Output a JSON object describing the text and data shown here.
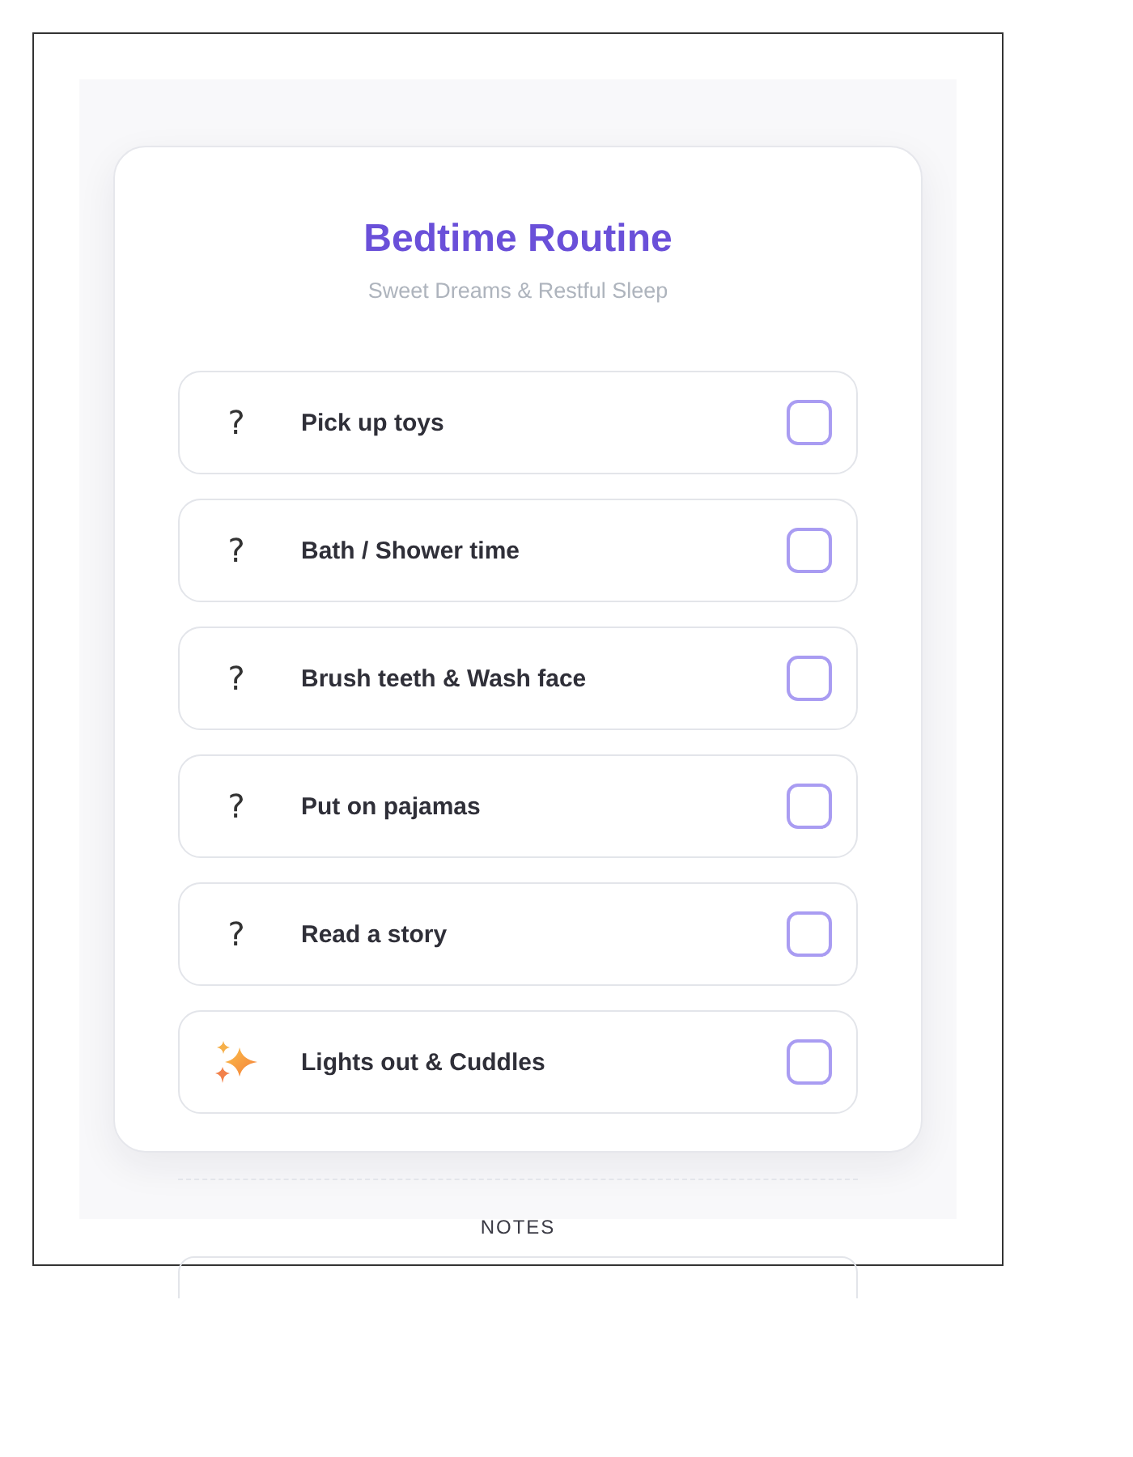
{
  "header": {
    "title": "Bedtime Routine",
    "subtitle": "Sweet Dreams & Restful Sleep"
  },
  "tasks": [
    {
      "kind": "glyph",
      "glyph": "?",
      "label": "Pick up toys",
      "checked": false
    },
    {
      "kind": "glyph",
      "glyph": "?",
      "label": "Bath / Shower time",
      "checked": false
    },
    {
      "kind": "glyph",
      "glyph": "?",
      "label": "Brush teeth & Wash face",
      "checked": false
    },
    {
      "kind": "glyph",
      "glyph": "?",
      "label": "Put on pajamas",
      "checked": false
    },
    {
      "kind": "glyph",
      "glyph": "?",
      "label": "Read a story",
      "checked": false
    },
    {
      "kind": "emoji",
      "label": "Lights out & Cuddles",
      "checked": false
    }
  ],
  "notes": {
    "label": "NOTES"
  }
}
